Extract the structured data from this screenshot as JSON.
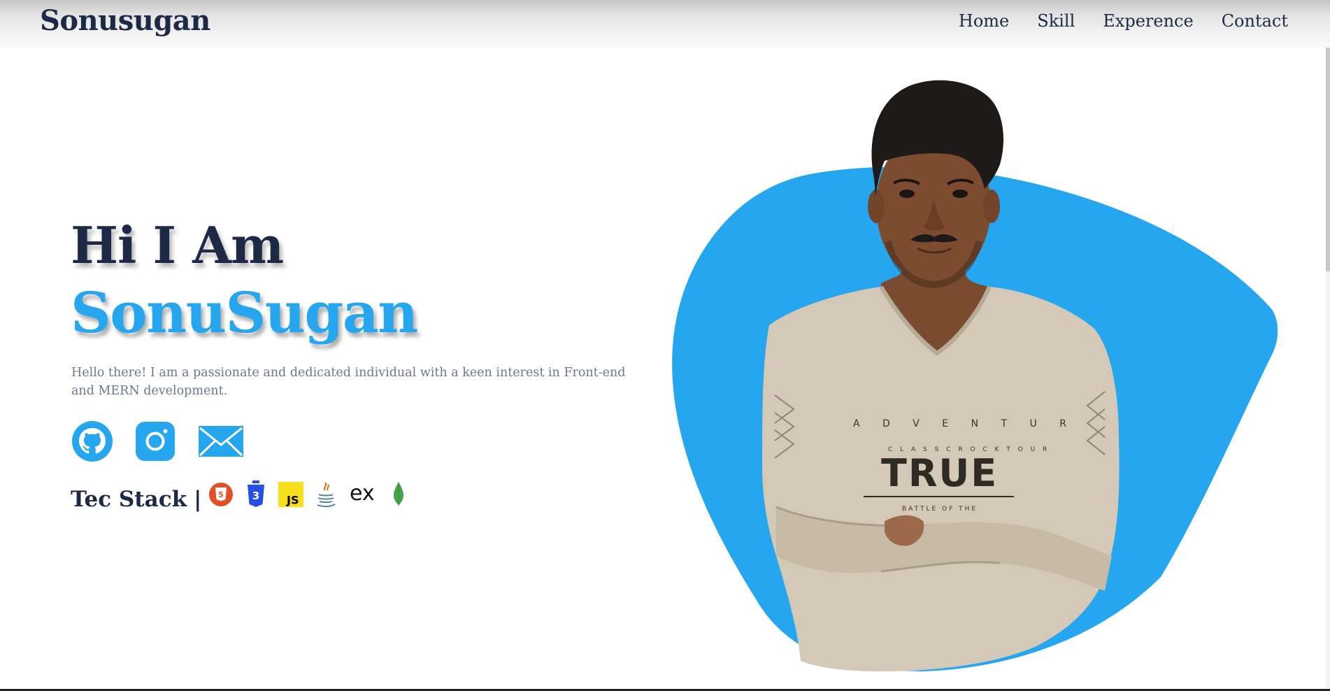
{
  "navbar": {
    "brand": "Sonusugan",
    "links": [
      {
        "label": "Home"
      },
      {
        "label": "Skill"
      },
      {
        "label": "Experence"
      },
      {
        "label": "Contact"
      }
    ]
  },
  "hero": {
    "greeting": "Hi I Am",
    "name": "SonuSugan",
    "intro": "Hello there! I am a passionate and dedicated individual with a keen interest in Front-end and MERN development.",
    "social": [
      {
        "icon": "github-icon"
      },
      {
        "icon": "instagram-icon"
      },
      {
        "icon": "mail-icon"
      }
    ],
    "tech_stack": {
      "label": "Tec Stack",
      "separator": "|",
      "icons": [
        {
          "icon": "html5-icon",
          "text": "5"
        },
        {
          "icon": "css3-icon",
          "text": "3"
        },
        {
          "icon": "javascript-icon",
          "text": "JS"
        },
        {
          "icon": "java-icon"
        },
        {
          "icon": "express-icon",
          "text": "ex"
        },
        {
          "icon": "mongodb-icon"
        }
      ]
    }
  },
  "colors": {
    "primary_dark": "#1e2a45",
    "accent_blue": "#26a6ee",
    "intro_text": "#6b7793",
    "html5": "#e34f26",
    "css3": "#264de4",
    "javascript": "#f7df1e",
    "mongodb": "#47a248"
  }
}
